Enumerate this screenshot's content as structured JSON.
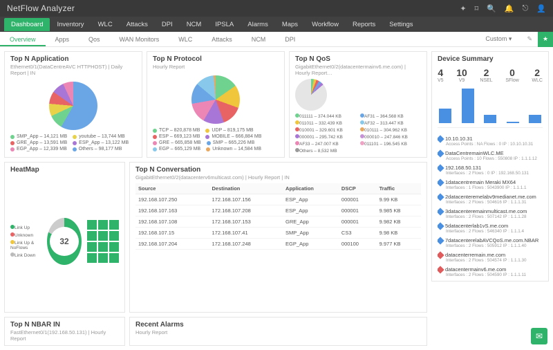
{
  "brand": "NetFlow Analyzer",
  "menu": [
    "Dashboard",
    "Inventory",
    "WLC",
    "Attacks",
    "DPI",
    "NCM",
    "IPSLA",
    "Alarms",
    "Maps",
    "Workflow",
    "Reports",
    "Settings"
  ],
  "submenu": [
    "Overview",
    "Apps",
    "Qos",
    "WAN Monitors",
    "WLC",
    "Attacks",
    "NCM",
    "DPI"
  ],
  "custom_label": "Custom",
  "topn_app": {
    "title": "Top N Application",
    "subtitle": "Ethernet0/1(DataCentreAVC HTTPHOST) | Daily Report | IN",
    "legend": [
      {
        "c": "#6fd38f",
        "t": "SMP_App – 14,121 MB"
      },
      {
        "c": "#e7d24a",
        "t": "youtube – 13,744 MB"
      },
      {
        "c": "#e86464",
        "t": "GRE_App – 13,591 MB"
      },
      {
        "c": "#a876d6",
        "t": "ESP_App – 13,122 MB"
      },
      {
        "c": "#ec86b4",
        "t": "EGP_App – 12,339 MB"
      },
      {
        "c": "#6aa6e6",
        "t": "Others – 98,177 MB"
      }
    ]
  },
  "topn_proto": {
    "title": "Top N Protocol",
    "subtitle": "Hourly Report",
    "legend": [
      {
        "c": "#6fd38f",
        "t": "TCP – 820,878 MB"
      },
      {
        "c": "#f0c63c",
        "t": "UDP – 819,175 MB"
      },
      {
        "c": "#e86464",
        "t": "ESP – 669,123 MB"
      },
      {
        "c": "#a876d6",
        "t": "MOBILE – 666,884 MB"
      },
      {
        "c": "#ec86b4",
        "t": "GRE – 665,858 MB"
      },
      {
        "c": "#6aa6e6",
        "t": "SMP – 665,226 MB"
      },
      {
        "c": "#88c8ea",
        "t": "EGP – 665,129 MB"
      },
      {
        "c": "#e8a860",
        "t": "Unknown – 14,584 MB"
      }
    ]
  },
  "topn_qos": {
    "title": "Top N QoS",
    "subtitle": "GigabitEthernet0/2(datacentermainv6.me.com) | Hourly Report…",
    "left": [
      {
        "c": "#6fd38f",
        "t": "011111 – 374.044 KB"
      },
      {
        "c": "#f0c63c",
        "t": "011011 – 332.439 KB"
      },
      {
        "c": "#e86464",
        "t": "010001 – 329.601 KB"
      },
      {
        "c": "#a876d6",
        "t": "000001 – 295.742 KB"
      },
      {
        "c": "#ec86b4",
        "t": "AF33 – 247.007 KB"
      },
      {
        "c": "#999",
        "t": "Others – 8,532 MB"
      }
    ],
    "right": [
      {
        "c": "#6aa6e6",
        "t": "AF31 – 364.568 KB"
      },
      {
        "c": "#88c8ea",
        "t": "AF32 – 313.447 KB"
      },
      {
        "c": "#e8a860",
        "t": "010111 – 304.962 KB"
      },
      {
        "c": "#c792d8",
        "t": "000010 – 247.846 KB"
      },
      {
        "c": "#f0a3c4",
        "t": "011101 – 196.545 KB"
      }
    ]
  },
  "heatmap": {
    "title": "HeatMap",
    "value": "32",
    "legend": [
      "Link Up",
      "Unknown",
      "Link Up & NoFlows",
      "Link Down"
    ]
  },
  "conversation": {
    "title": "Top N Conversation",
    "subtitle": "GigabitEthernet0/2(datacenterv6multicast.com) | Hourly Report | IN",
    "headers": [
      "Source",
      "Destination",
      "Application",
      "DSCP",
      "Traffic"
    ],
    "rows": [
      [
        "192.168.107.250",
        "172.168.107.156",
        "ESP_App",
        "000001",
        "9.99 KB"
      ],
      [
        "192.168.107.163",
        "172.168.107.208",
        "ESP_App",
        "000001",
        "9.985 KB"
      ],
      [
        "192.168.107.108",
        "172.168.107.153",
        "GRE_App",
        "000001",
        "9.982 KB"
      ],
      [
        "192.168.107.15",
        "172.168.107.41",
        "SMP_App",
        "CS3",
        "9.98 KB"
      ],
      [
        "192.168.107.204",
        "172.168.107.248",
        "EGP_App",
        "000100",
        "9.977 KB"
      ]
    ]
  },
  "nbar": {
    "title": "Top N NBAR IN",
    "subtitle": "FastEthernet0/1(192.168.50.131) | Hourly Report"
  },
  "alarms": {
    "title": "Recent Alarms",
    "subtitle": "Hourly Report"
  },
  "summary": {
    "title": "Device Summary",
    "cols": [
      {
        "n": "4",
        "l": "V5"
      },
      {
        "n": "10",
        "l": "V9"
      },
      {
        "n": "2",
        "l": "NSEL"
      },
      {
        "n": "0",
        "l": "SFlow"
      },
      {
        "n": "2",
        "l": "WLC"
      }
    ],
    "devices": [
      {
        "name": "10.10.10.31",
        "info": "Access Points : NA   Flows : 0   IP : 10.10.10.31",
        "red": false
      },
      {
        "name": "DataCentremainWLC.ME",
        "info": "Access Points : 10   Flows : 550808   IP : 1.1.1.12",
        "red": false
      },
      {
        "name": "192.168.50.131",
        "info": "Interfaces : 2   Flows : 0   IP : 192.168.50.131",
        "red": false
      },
      {
        "name": "1datacentremain Meraki MX64",
        "info": "Interfaces : 1   Flows : 5043900   IP : 1.1.1.1",
        "red": false
      },
      {
        "name": "2datacenteremelabv9medianet.me.com",
        "info": "Interfaces : 2   Flows : 504616   IP : 1.1.1.31",
        "red": false
      },
      {
        "name": "3datacenteremainmulticast.me.com",
        "info": "Interfaces : 2   Flows : 507142   IP : 1.1.1.28",
        "red": false
      },
      {
        "name": "5datacenterlab1vS.me.com",
        "info": "Interfaces : 2   Flows : 546340   IP : 1.1.1.4",
        "red": false
      },
      {
        "name": "7datacenterelabAVCQoS.me.com.NBAR",
        "info": "Interfaces : 2   Flows : 505912   IP : 1.1.1.40",
        "red": false
      },
      {
        "name": "datacenterremain.me.com",
        "info": "Interfaces : 2   Flows : 504574   IP : 1.1.1.30",
        "red": true
      },
      {
        "name": "datacentermainv6.me.com",
        "info": "Interfaces : 2   Flows : 504590   IP : 1.1.1.11",
        "red": true
      }
    ]
  },
  "chart_data": {
    "type": "bar",
    "title": "Device Summary",
    "categories": [
      "V5",
      "V9",
      "NSEL",
      "SFlow",
      "WLC"
    ],
    "values": [
      4,
      10,
      2,
      0,
      2
    ],
    "ylim": [
      0,
      10
    ]
  }
}
